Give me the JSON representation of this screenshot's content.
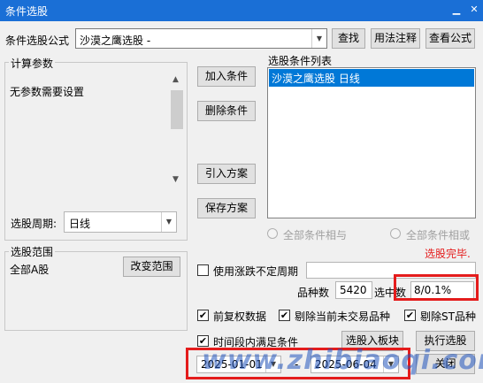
{
  "window": {
    "title": "条件选股"
  },
  "formula": {
    "label": "条件选股公式",
    "value": "沙漠之鹰选股  -",
    "find": "查找",
    "usage": "用法注释",
    "view": "查看公式"
  },
  "params": {
    "group_label": "计算参数",
    "text": "无参数需要设置",
    "period_label": "选股周期:",
    "period_value": "日线"
  },
  "actions": {
    "add": "加入条件",
    "delete": "删除条件",
    "import": "引入方案",
    "save": "保存方案"
  },
  "list": {
    "label": "选股条件列表",
    "items": [
      "沙漠之鹰选股  日线"
    ]
  },
  "logic": {
    "and": "全部条件相与",
    "or": "全部条件相或"
  },
  "status": {
    "done": "选股完毕."
  },
  "scope": {
    "group_label": "选股范围",
    "value": "全部A股",
    "change": "改变范围"
  },
  "unfixed": {
    "label": "使用涨跌不定周期"
  },
  "stats": {
    "count_label": "品种数",
    "count_value": "5420",
    "selected_label": "选中数",
    "selected_value": "8/0.1%"
  },
  "options": {
    "adjust": "前复权数据",
    "exclude_untraded": "剔除当前未交易品种",
    "exclude_st": "剔除ST品种",
    "time_range": "时间段内满足条件"
  },
  "buttons": {
    "to_block": "选股入板块",
    "execute": "执行选股",
    "close": "关闭"
  },
  "dates": {
    "start": "2025-01-01",
    "separator": "-",
    "end": "2025-06-04"
  },
  "watermark": "www.zhibiaoqi.com",
  "colors": {
    "titlebar": "#1a6fd6",
    "selection": "#0078d7",
    "status_red": "#e41c1c",
    "highlight_box": "#e41c1c"
  }
}
